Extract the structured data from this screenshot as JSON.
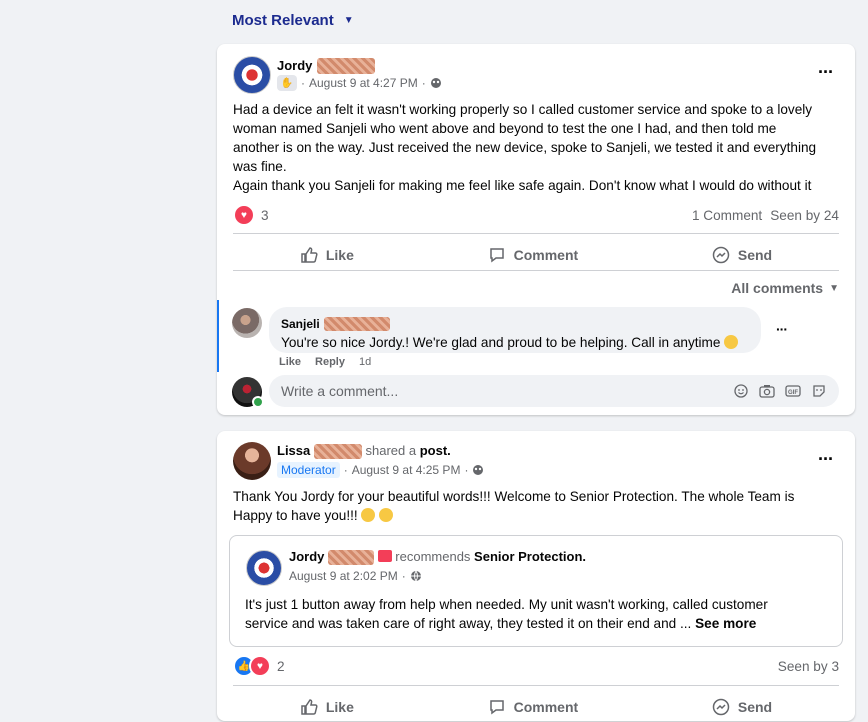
{
  "sort": {
    "label": "Most Relevant"
  },
  "post1": {
    "author": "Jordy",
    "date": "August 9 at 4:27 PM",
    "text_lines": [
      "Had a device an felt it wasn't working properly so I called customer service and spoke to a lovely",
      "woman named Sanjeli who went above and beyond to test the one I had, and then told me",
      "another is on the way. Just received the new device, spoke to Sanjeli, we tested it and everything",
      "was fine.",
      "Again thank you Sanjeli for making me feel like safe again. Don't know what I would do without it"
    ],
    "reactions_count": "3",
    "comments_count": "1 Comment",
    "seen_by": "Seen by 24",
    "actions": {
      "like": "Like",
      "comment": "Comment",
      "send": "Send"
    },
    "all_comments": "All comments",
    "comment": {
      "author": "Sanjeli",
      "text": "You're so nice Jordy.! We're glad and proud to be helping. Call in anytime",
      "like": "Like",
      "reply": "Reply",
      "time": "1d"
    },
    "write_placeholder": "Write a comment..."
  },
  "post2": {
    "author": "Lissa",
    "shared_a": "shared a",
    "post_word": "post.",
    "badge": "Moderator",
    "date": "August 9 at 4:25 PM",
    "text_lines": [
      "Thank You Jordy for your beautiful words!!! Welcome to Senior Protection. The whole Team is",
      "Happy to have you!!!"
    ],
    "shared": {
      "author": "Jordy",
      "recommends": "recommends",
      "page": "Senior Protection.",
      "date": "August 9 at 2:02 PM",
      "text_lines": [
        "It's just 1 button away from help when needed. My unit wasn't working, called customer",
        "service and was taken care of right away, they tested it on their end and ..."
      ],
      "see_more": "See more"
    },
    "reactions_count": "2",
    "seen_by": "Seen by 3",
    "actions": {
      "like": "Like",
      "comment": "Comment",
      "send": "Send"
    }
  }
}
